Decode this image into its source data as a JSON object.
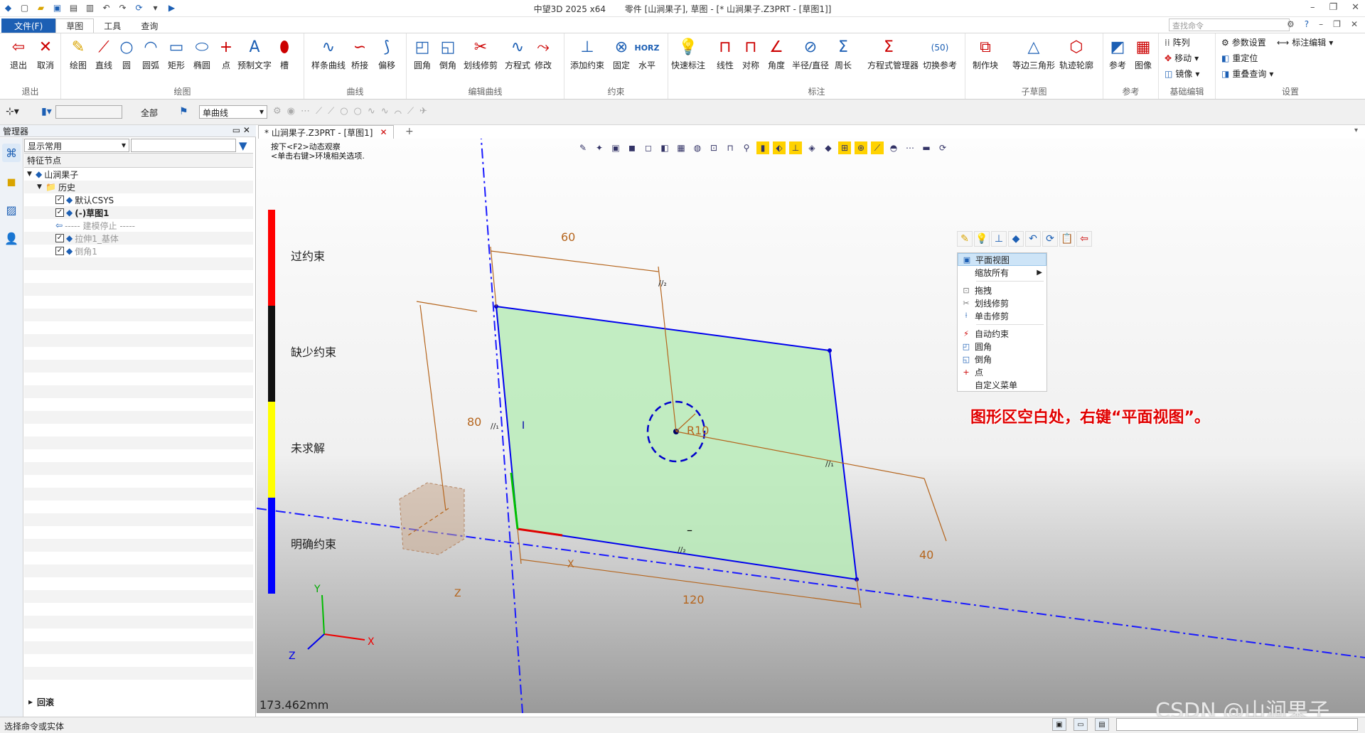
{
  "window": {
    "app_title": "中望3D 2025 x64",
    "doc_title": "零件 [山涧果子], 草图 - [* 山涧果子.Z3PRT - [草图1]]"
  },
  "menu": {
    "file": "文件(F)",
    "tabs": [
      "草图",
      "工具",
      "查询"
    ],
    "search_placeholder": "查找命令"
  },
  "ribbon": {
    "groups": [
      {
        "label": "退出",
        "buttons": [
          "退出",
          "取消"
        ]
      },
      {
        "label": "绘图",
        "buttons": [
          "绘图",
          "直线",
          "圆",
          "圆弧",
          "矩形",
          "椭圆",
          "点",
          "预制文字",
          "槽"
        ]
      },
      {
        "label": "曲线",
        "buttons": [
          "样条曲线",
          "桥接",
          "偏移"
        ]
      },
      {
        "label": "编辑曲线",
        "buttons": [
          "圆角",
          "倒角",
          "划线修剪",
          "方程式",
          "修改"
        ]
      },
      {
        "label": "约束",
        "buttons": [
          "添加约束",
          "固定",
          "水平"
        ]
      },
      {
        "label": "标注",
        "buttons": [
          "快速标注",
          "线性",
          "对称",
          "角度",
          "半径/直径",
          "周长",
          "方程式管理器",
          "切换参考"
        ]
      },
      {
        "label": "子草图",
        "buttons": [
          "制作块",
          "等边三角形",
          "轨迹轮廓"
        ]
      },
      {
        "label": "参考",
        "buttons": [
          "参考",
          "图像"
        ]
      },
      {
        "label": "基础编辑",
        "buttons": [
          "阵列",
          "移动",
          "镜像"
        ]
      },
      {
        "label": "设置",
        "buttons": [
          "参数设置",
          "重定位",
          "重叠查询",
          "标注编辑"
        ]
      }
    ]
  },
  "filterbar": {
    "filter_all": "全部",
    "curve_mode": "单曲线"
  },
  "manager": {
    "title": "管理器",
    "display_mode": "显示常用",
    "column_header": "特征节点",
    "tree": [
      {
        "label": "山涧果子",
        "indent": 0,
        "check": false,
        "bold": false,
        "gray": false
      },
      {
        "label": "历史",
        "indent": 1,
        "check": false,
        "bold": false,
        "gray": false
      },
      {
        "label": "默认CSYS",
        "indent": 2,
        "check": true,
        "bold": false,
        "gray": false
      },
      {
        "label": "(-)草图1",
        "indent": 2,
        "check": true,
        "bold": true,
        "gray": false
      },
      {
        "label": "----- 建模停止 -----",
        "indent": 2,
        "check": false,
        "bold": false,
        "gray": true
      },
      {
        "label": "拉伸1_基体",
        "indent": 2,
        "check": true,
        "bold": false,
        "gray": true
      },
      {
        "label": "倒角1",
        "indent": 2,
        "check": true,
        "bold": false,
        "gray": true
      }
    ],
    "rollback": "回滚"
  },
  "doc_tab": "* 山涧果子.Z3PRT - [草图1]",
  "canvas": {
    "hint_line1": "按下<F2>动态观察",
    "hint_line2": "<单击右键>环境相关选项.",
    "legend": [
      "过约束",
      "缺少约束",
      "未求解",
      "明确约束"
    ],
    "legend_colors": [
      "#ff0000",
      "#111111",
      "#ffff00",
      "#0000ff"
    ],
    "dims": {
      "top": "60",
      "left": "80",
      "right": "40",
      "bottom": "120",
      "radius": "R10"
    },
    "axes": {
      "x": "X",
      "y": "Y",
      "z": "Z"
    },
    "distance": "173.462mm",
    "annotation": "图形区空白处，右键“平面视图”。",
    "watermark": "CSDN @山涧果子"
  },
  "context_menu": {
    "items": [
      "平面视图",
      "缩放所有",
      "拖拽",
      "划线修剪",
      "单击修剪",
      "自动约束",
      "圆角",
      "倒角",
      "点",
      "自定义菜单"
    ]
  },
  "status": {
    "text": "选择命令或实体"
  }
}
